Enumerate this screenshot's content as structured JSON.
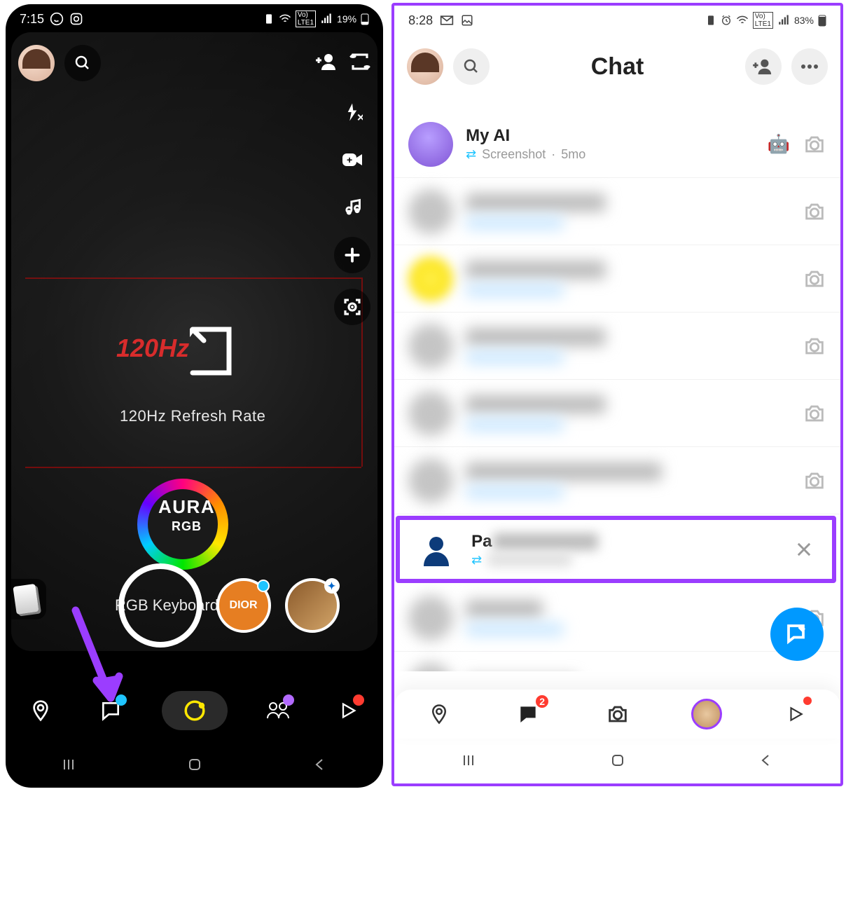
{
  "left": {
    "status": {
      "time": "7:15",
      "battery": "19%",
      "net": "LTE1"
    },
    "camera_overlay": {
      "hz": "120Hz",
      "refresh": "120Hz Refresh Rate",
      "aura": "AURA",
      "aura_sub": "RGB",
      "keyboard": "RGB Keyboard"
    },
    "lenses": {
      "dior": "DIOR"
    },
    "nav": {
      "map": "map",
      "chat": "chat",
      "camera": "camera",
      "stories": "stories",
      "spotlight": "spotlight"
    }
  },
  "right": {
    "status": {
      "time": "8:28",
      "battery": "83%",
      "net": "LTE1"
    },
    "header": {
      "title": "Chat"
    },
    "items": [
      {
        "name": "My AI",
        "status": "Screenshot",
        "meta": "5mo",
        "emoji": "🤖",
        "avatar": "ai",
        "trail": "camera"
      },
      {
        "name": "Blurred 1",
        "avatar": "blur",
        "blurred": true,
        "trail": "camera"
      },
      {
        "name": "Blurred 2",
        "avatar": "yellow",
        "blurred": true,
        "trail": "camera"
      },
      {
        "name": "Blurred 3",
        "avatar": "blur",
        "blurred": true,
        "trail": "camera"
      },
      {
        "name": "Blurred 4",
        "avatar": "blur",
        "blurred": true,
        "trail": "camera"
      },
      {
        "name": "Blurred 5",
        "avatar": "blur",
        "blurred": true,
        "trail": "camera"
      },
      {
        "name": "Pa",
        "avatar": "person",
        "highlight": true,
        "trail": "close"
      },
      {
        "name": "Blurred 7",
        "avatar": "blur",
        "blurred": true,
        "trail": "camera"
      },
      {
        "name": "Blurred 8",
        "avatar": "blur",
        "blurred": true,
        "trail": "camera"
      }
    ],
    "nav": {
      "chat_badge": "2"
    }
  }
}
